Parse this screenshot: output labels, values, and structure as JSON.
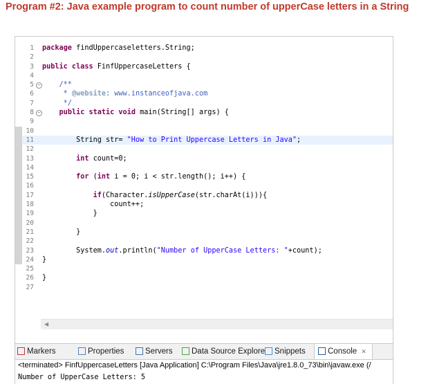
{
  "heading": "Program #2: Java example program to count number of upperCase letters in a String",
  "editor": {
    "lines": [
      {
        "n": "1",
        "segs": [
          {
            "t": "package",
            "c": "kw"
          },
          {
            "t": " findUppercaseletters.String;"
          }
        ]
      },
      {
        "n": "2",
        "segs": []
      },
      {
        "n": "3",
        "segs": [
          {
            "t": "public class",
            "c": "kw"
          },
          {
            "t": " FinfUppercaseLetters {"
          }
        ]
      },
      {
        "n": "4",
        "segs": []
      },
      {
        "n": "5",
        "fold": "−",
        "segs": [
          {
            "t": "    /**",
            "c": "cmt"
          }
        ]
      },
      {
        "n": "6",
        "segs": [
          {
            "t": "     * ",
            "c": "cmt"
          },
          {
            "t": "@website",
            "c": "tag"
          },
          {
            "t": ": www.instanceofjava.com",
            "c": "cmt"
          }
        ]
      },
      {
        "n": "7",
        "segs": [
          {
            "t": "     */",
            "c": "cmt"
          }
        ]
      },
      {
        "n": "8",
        "fold": "−",
        "segs": [
          {
            "t": "    "
          },
          {
            "t": "public static void",
            "c": "kw"
          },
          {
            "t": " main(String[] args) {"
          }
        ]
      },
      {
        "n": "9",
        "segs": []
      },
      {
        "n": "10",
        "stripe": true,
        "segs": []
      },
      {
        "n": "11",
        "stripe": true,
        "hl": true,
        "segs": [
          {
            "t": "        String str= "
          },
          {
            "t": "\"How to Print Uppercase Letters in Java\"",
            "c": "str"
          },
          {
            "t": ";"
          }
        ]
      },
      {
        "n": "12",
        "stripe": true,
        "segs": []
      },
      {
        "n": "13",
        "stripe": true,
        "segs": [
          {
            "t": "        "
          },
          {
            "t": "int",
            "c": "kw"
          },
          {
            "t": " count=0;"
          }
        ]
      },
      {
        "n": "14",
        "stripe": true,
        "segs": []
      },
      {
        "n": "15",
        "stripe": true,
        "segs": [
          {
            "t": "        "
          },
          {
            "t": "for",
            "c": "kw"
          },
          {
            "t": " ("
          },
          {
            "t": "int",
            "c": "kw"
          },
          {
            "t": " i = 0; i < str.length(); i++) {"
          }
        ]
      },
      {
        "n": "16",
        "stripe": true,
        "segs": []
      },
      {
        "n": "17",
        "stripe": true,
        "segs": [
          {
            "t": "            "
          },
          {
            "t": "if",
            "c": "kw"
          },
          {
            "t": "(Character."
          },
          {
            "t": "isUpperCase",
            "c": "it"
          },
          {
            "t": "(str.charAt(i))){"
          }
        ]
      },
      {
        "n": "18",
        "stripe": true,
        "segs": [
          {
            "t": "                count++;"
          }
        ]
      },
      {
        "n": "19",
        "stripe": true,
        "segs": [
          {
            "t": "            }"
          }
        ]
      },
      {
        "n": "20",
        "stripe": true,
        "segs": []
      },
      {
        "n": "21",
        "stripe": true,
        "segs": [
          {
            "t": "        }"
          }
        ]
      },
      {
        "n": "22",
        "stripe": true,
        "segs": []
      },
      {
        "n": "23",
        "stripe": true,
        "segs": [
          {
            "t": "        System."
          },
          {
            "t": "out",
            "c": "fld"
          },
          {
            "t": ".println("
          },
          {
            "t": "\"Number of UpperCase Letters: \"",
            "c": "str"
          },
          {
            "t": "+count);"
          }
        ]
      },
      {
        "n": "24",
        "stripe": true,
        "segs": [
          {
            "t": "}"
          }
        ]
      },
      {
        "n": "25",
        "segs": []
      },
      {
        "n": "26",
        "segs": [
          {
            "t": "}"
          }
        ]
      },
      {
        "n": "27",
        "segs": []
      }
    ]
  },
  "views": {
    "tabs": [
      {
        "label": "Markers",
        "icon": "markers-icon",
        "color": "#c0392b"
      },
      {
        "label": "Properties",
        "icon": "properties-icon",
        "color": "#5a7fb5"
      },
      {
        "label": "Servers",
        "icon": "servers-icon",
        "color": "#4a6fa5"
      },
      {
        "label": "Data Source Explorer",
        "icon": "data-source-explorer-icon",
        "color": "#5a9e3a"
      },
      {
        "label": "Snippets",
        "icon": "snippets-icon",
        "color": "#4a8fc5"
      },
      {
        "label": "Console",
        "icon": "console-icon",
        "color": "#2c5aa0",
        "active": true,
        "close": "✕"
      }
    ]
  },
  "console": {
    "terminated": "<terminated> FinfUppercaseLetters [Java Application] C:\\Program Files\\Java\\jre1.8.0_73\\bin\\javaw.exe (/",
    "output": "Number of UpperCase Letters: 5"
  }
}
